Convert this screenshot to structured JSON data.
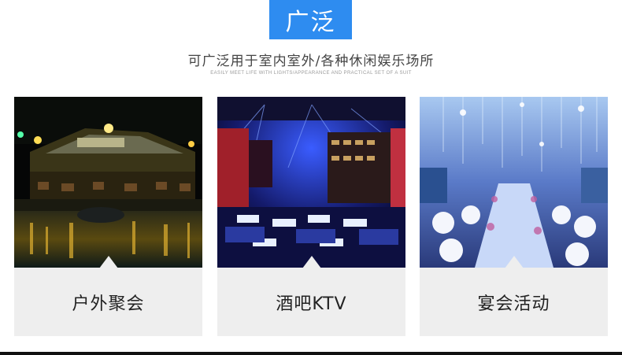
{
  "header": {
    "badge": "广泛"
  },
  "intro": {
    "subtitle": "可广泛用于室内室外/各种休闲娱乐场所",
    "tagline": "EASILY MEET LIFE WITH LIGHTS/APPEARANCE AND PRACTICAL SET OF A SUIT"
  },
  "cards": [
    {
      "caption": "户外聚会",
      "image": "outdoor-party-photo"
    },
    {
      "caption": "酒吧KTV",
      "image": "bar-ktv-photo"
    },
    {
      "caption": "宴会活动",
      "image": "banquet-event-photo"
    }
  ],
  "colors": {
    "accent": "#2e8cf0",
    "caption_bg": "#eeeeee",
    "text": "#222222"
  }
}
